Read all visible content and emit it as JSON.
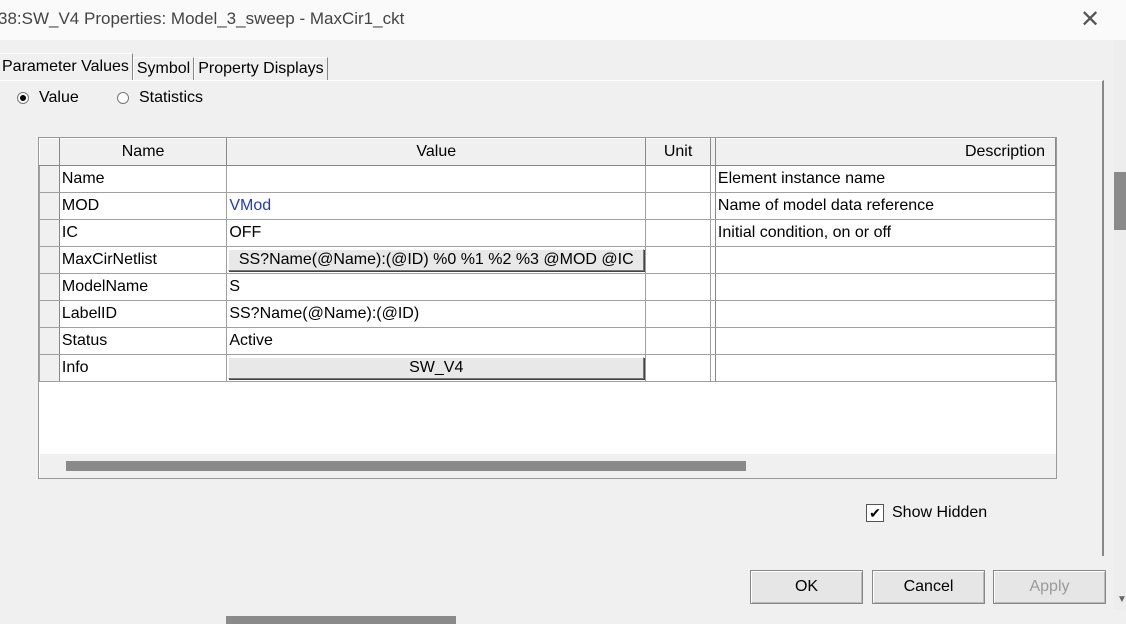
{
  "window": {
    "title": "38:SW_V4 Properties: Model_3_sweep - MaxCir1_ckt",
    "close_symbol": "✕"
  },
  "tabs": [
    {
      "label": "Parameter Values",
      "active": true
    },
    {
      "label": "Symbol",
      "active": false
    },
    {
      "label": "Property Displays",
      "active": false
    }
  ],
  "mode": {
    "value_label": "Value",
    "statistics_label": "Statistics",
    "selected": "Value"
  },
  "table": {
    "columns": [
      "Name",
      "Value",
      "Unit",
      "Description"
    ],
    "rows": [
      {
        "name": "Name",
        "value": "",
        "unit": "",
        "description": "Element instance name"
      },
      {
        "name": "MOD",
        "value": "VMod",
        "unit": "",
        "description": "Name of model data reference"
      },
      {
        "name": "IC",
        "value": "OFF",
        "unit": "",
        "description": "Initial condition, on or off"
      },
      {
        "name": "MaxCirNetlist",
        "value": "SS?Name(@Name):(@ID) %0 %1 %2 %3 @MOD @IC",
        "unit": "",
        "description": ""
      },
      {
        "name": "ModelName",
        "value": "S",
        "unit": "",
        "description": ""
      },
      {
        "name": "LabelID",
        "value": "SS?Name(@Name):(@ID)",
        "unit": "",
        "description": ""
      },
      {
        "name": "Status",
        "value": "Active",
        "unit": "",
        "description": ""
      },
      {
        "name": "Info",
        "value": "SW_V4",
        "unit": "",
        "description": ""
      }
    ]
  },
  "options": {
    "show_hidden_label": "Show Hidden",
    "show_hidden": true,
    "checkmark": "✔"
  },
  "buttons": {
    "ok": "OK",
    "cancel": "Cancel",
    "apply": "Apply"
  },
  "scroll_arrow": "▼"
}
